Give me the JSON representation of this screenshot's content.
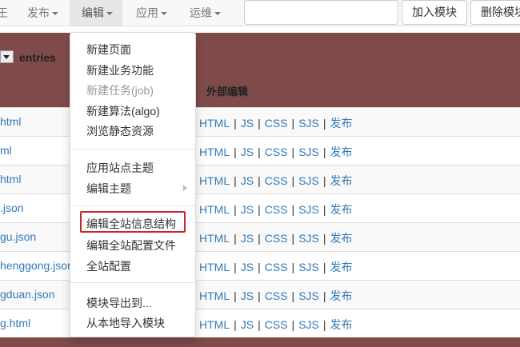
{
  "navbar": {
    "items": [
      {
        "label": "王",
        "caret": false
      },
      {
        "label": "发布",
        "caret": true
      },
      {
        "label": "编辑",
        "caret": true,
        "active": true
      },
      {
        "label": "应用",
        "caret": true
      },
      {
        "label": "运维",
        "caret": true
      }
    ],
    "search_value": "",
    "add_module_label": "加入模块",
    "delete_module_label": "删除模块"
  },
  "table": {
    "entries_label": "entries",
    "external_edit_header": "外部编辑",
    "rows": [
      {
        "file": "html"
      },
      {
        "file": "ml"
      },
      {
        "file": "html"
      },
      {
        "file": ".json"
      },
      {
        "file": "gu.json"
      },
      {
        "file": "henggong.json"
      },
      {
        "file": "gduan.json"
      },
      {
        "file": "g.html"
      }
    ],
    "actions": [
      "HTML",
      "JS",
      "CSS",
      "SJS",
      "发布"
    ],
    "separator": "|"
  },
  "dropdown": {
    "groups": [
      [
        {
          "label": "新建页面",
          "disabled": false
        },
        {
          "label": "新建业务功能",
          "disabled": false
        },
        {
          "label": "新建任务(job)",
          "disabled": true
        },
        {
          "label": "新建算法(algo)",
          "disabled": false
        },
        {
          "label": "浏览静态资源",
          "disabled": false
        }
      ],
      [
        {
          "label": "应用站点主题",
          "disabled": false
        },
        {
          "label": "编辑主题",
          "disabled": false,
          "submenu": true
        }
      ],
      [
        {
          "label": "编辑全站信息结构",
          "disabled": false,
          "highlighted": true
        },
        {
          "label": "编辑全站配置文件",
          "disabled": false
        },
        {
          "label": "全站配置",
          "disabled": false
        }
      ],
      [
        {
          "label": "模块导出到...",
          "disabled": false
        },
        {
          "label": "从本地导入模块",
          "disabled": false
        }
      ]
    ]
  },
  "colors": {
    "panel": "#7f4a4a",
    "link": "#337ab7",
    "highlight_border": "#c9252c",
    "navbar": "#f8f8f8"
  }
}
